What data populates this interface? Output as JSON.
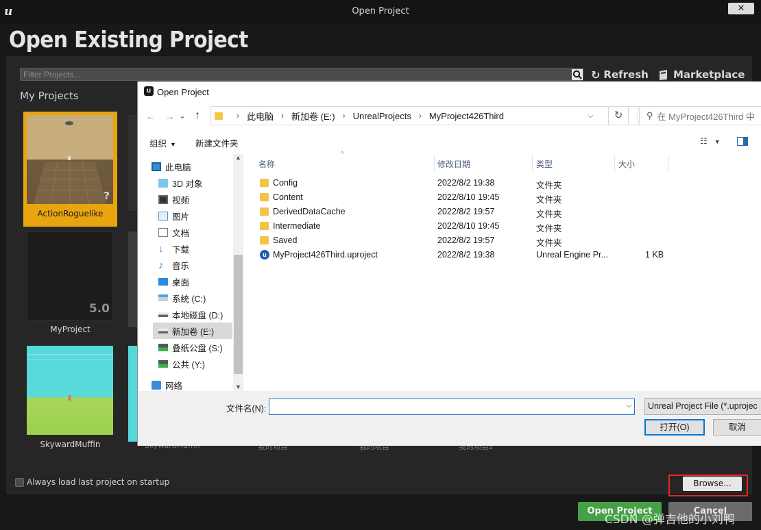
{
  "launcher": {
    "window_title": "Open Project",
    "close_label": "✕",
    "heading": "Open Existing Project",
    "filter_placeholder": "Filter Projects...",
    "refresh_label": "Refresh",
    "marketplace_label": "Marketplace",
    "section_label": "My Projects",
    "projects": [
      {
        "name": "ActionRoguelike",
        "badge": "?"
      },
      {
        "name": "MyProject",
        "badge": "5.0"
      },
      {
        "name": "SkywardMuffin",
        "badge": ""
      }
    ],
    "partially_hidden_labels": [
      "SkywardMuffin",
      "我的项目",
      "我的项目",
      "我的项目2"
    ],
    "always_load_label": "Always load last project on startup",
    "browse_label": "Browse...",
    "open_project_label": "Open Project",
    "cancel_label": "Cancel",
    "watermark": "CSDN @弹吉他的小刘鸭"
  },
  "dialog": {
    "title": "Open Project",
    "breadcrumb": [
      "此电脑",
      "新加卷 (E:)",
      "UnrealProjects",
      "MyProject426Third"
    ],
    "search_placeholder": "在 MyProject426Third 中",
    "toolbar": {
      "organize": "组织",
      "new_folder": "新建文件夹"
    },
    "nav_items": [
      {
        "label": "此电脑",
        "icon": "pc-icon"
      },
      {
        "label": "3D 对象",
        "icon": "3d-objects-icon"
      },
      {
        "label": "视频",
        "icon": "video-icon"
      },
      {
        "label": "图片",
        "icon": "pictures-icon"
      },
      {
        "label": "文档",
        "icon": "documents-icon"
      },
      {
        "label": "下载",
        "icon": "download-icon"
      },
      {
        "label": "音乐",
        "icon": "music-icon"
      },
      {
        "label": "桌面",
        "icon": "desktop-icon"
      },
      {
        "label": "系统 (C:)",
        "icon": "drive-icon"
      },
      {
        "label": "本地磁盘 (D:)",
        "icon": "drive-icon"
      },
      {
        "label": "新加卷 (E:)",
        "icon": "drive-icon"
      },
      {
        "label": "叠纸公盘 (S:)",
        "icon": "network-drive-icon"
      },
      {
        "label": "公共 (Y:)",
        "icon": "network-drive-icon"
      },
      {
        "label": "网络",
        "icon": "network-icon"
      }
    ],
    "columns": {
      "name": "名称",
      "date": "修改日期",
      "type": "类型",
      "size": "大小"
    },
    "files": [
      {
        "name": "Config",
        "date": "2022/8/2 19:38",
        "type": "文件夹",
        "size": "",
        "kind": "folder"
      },
      {
        "name": "Content",
        "date": "2022/8/10 19:45",
        "type": "文件夹",
        "size": "",
        "kind": "folder"
      },
      {
        "name": "DerivedDataCache",
        "date": "2022/8/2 19:57",
        "type": "文件夹",
        "size": "",
        "kind": "folder"
      },
      {
        "name": "Intermediate",
        "date": "2022/8/10 19:45",
        "type": "文件夹",
        "size": "",
        "kind": "folder"
      },
      {
        "name": "Saved",
        "date": "2022/8/2 19:57",
        "type": "文件夹",
        "size": "",
        "kind": "folder"
      },
      {
        "name": "MyProject426Third.uproject",
        "date": "2022/8/2 19:38",
        "type": "Unreal Engine Pr...",
        "size": "1 KB",
        "kind": "uproject"
      }
    ],
    "filename_label": "文件名(N):",
    "filename_value": "",
    "filetype_value": "Unreal Project File (*.uprojec",
    "open_label": "打开(O)",
    "cancel_label": "取消"
  },
  "colors": {
    "selected_tile": "#e9a50f",
    "open_project_button": "#46a046",
    "highlight_box": "#e2272a",
    "dialog_accent": "#0078d7"
  }
}
